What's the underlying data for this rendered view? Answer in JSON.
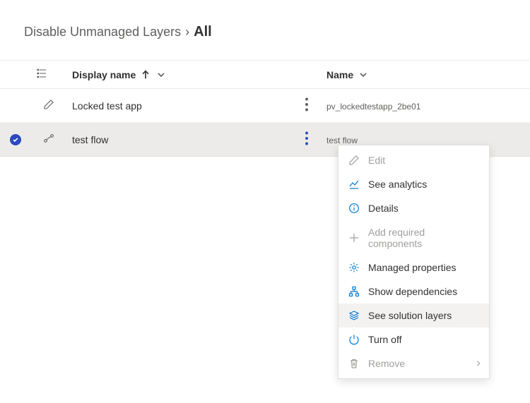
{
  "breadcrumb": {
    "parent": "Disable Unmanaged Layers",
    "current": "All"
  },
  "columns": {
    "display_name": "Display name",
    "name": "Name"
  },
  "rows": [
    {
      "selected": false,
      "type_icon": "pencil-icon",
      "display_name": "Locked test app",
      "name": "pv_lockedtestapp_2be01"
    },
    {
      "selected": true,
      "type_icon": "flow-icon",
      "display_name": "test flow",
      "name": "test flow"
    }
  ],
  "menu": {
    "items": [
      {
        "icon": "pencil-icon",
        "label": "Edit",
        "disabled": true
      },
      {
        "icon": "analytics-icon",
        "label": "See analytics",
        "disabled": false
      },
      {
        "icon": "info-icon",
        "label": "Details",
        "disabled": false
      },
      {
        "icon": "plus-icon",
        "label": "Add required components",
        "disabled": true
      },
      {
        "icon": "gear-icon",
        "label": "Managed properties",
        "disabled": false
      },
      {
        "icon": "hierarchy-icon",
        "label": "Show dependencies",
        "disabled": false
      },
      {
        "icon": "layers-icon",
        "label": "See solution layers",
        "disabled": false,
        "hover": true
      },
      {
        "icon": "power-icon",
        "label": "Turn off",
        "disabled": false
      },
      {
        "icon": "trash-icon",
        "label": "Remove",
        "disabled": true,
        "submenu": true
      }
    ]
  }
}
